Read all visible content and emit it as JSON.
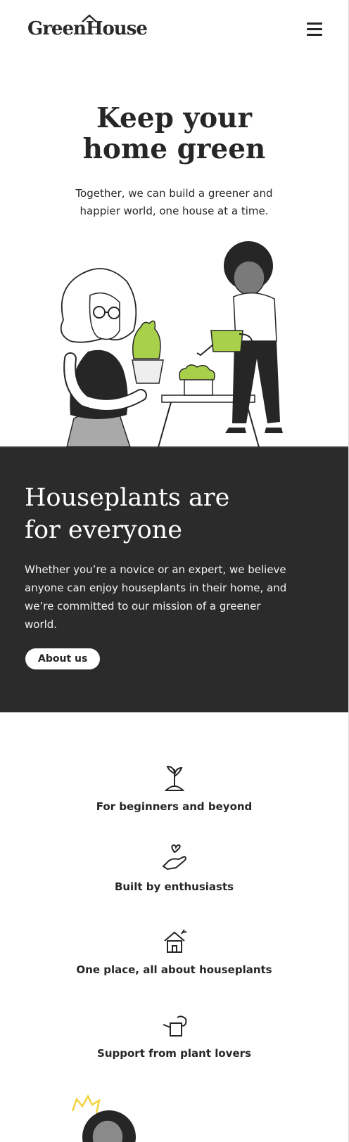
{
  "header": {
    "logo": "GreenHouse",
    "menu_icon": "hamburger-menu-icon"
  },
  "hero": {
    "title_line1": "Keep your",
    "title_line2": "home green",
    "subtitle_line1": "Together, we can build a greener and",
    "subtitle_line2": "happier world, one house at a time."
  },
  "about": {
    "title_line1": "Houseplants are",
    "title_line2": "for everyone",
    "body_line1": "Whether you’re a novice or an expert, we believe",
    "body_line2": "anyone can enjoy houseplants in their home, and",
    "body_line3": "we’re committed to our mission of a greener",
    "body_line4": "world.",
    "button_label": "About us"
  },
  "features": [
    {
      "icon": "sprout-icon",
      "label": "For beginners and beyond"
    },
    {
      "icon": "heart-hand-icon",
      "label": "Built by enthusiasts"
    },
    {
      "icon": "house-plant-icon",
      "label": "One place, all about houseplants"
    },
    {
      "icon": "watering-can-icon",
      "label": "Support from plant lovers"
    }
  ],
  "colors": {
    "dark_band": "#2b2b2b",
    "text": "#262626",
    "plant_green": "#a8d04a"
  }
}
